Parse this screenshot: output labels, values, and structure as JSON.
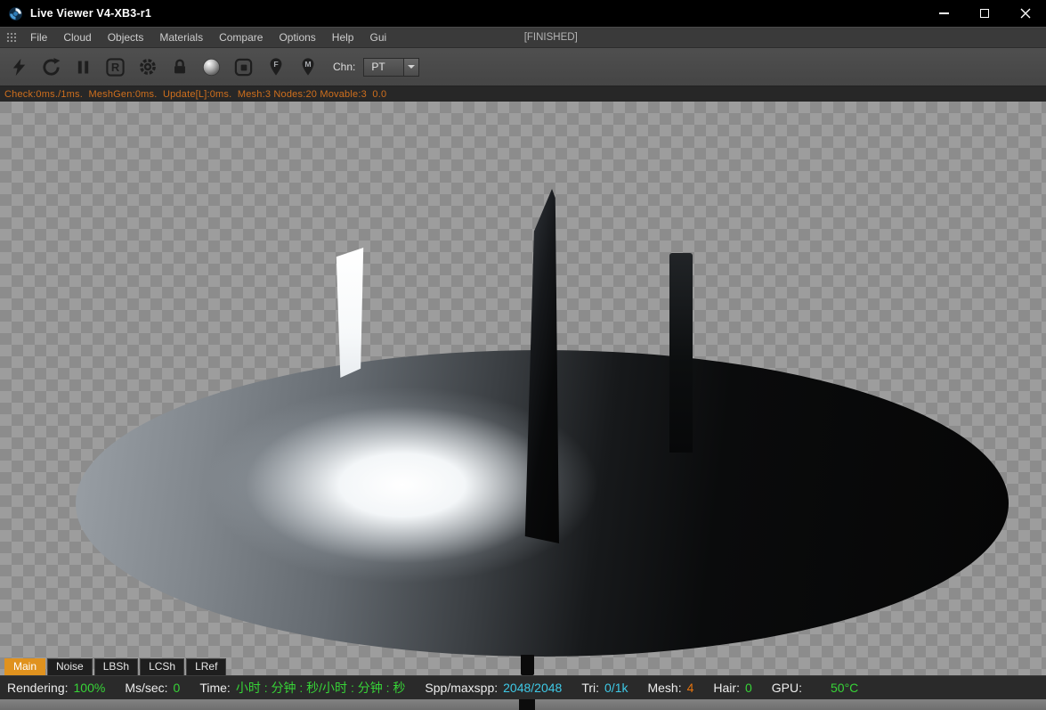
{
  "window": {
    "title": "Live Viewer V4-XB3-r1"
  },
  "menu": {
    "items": [
      "File",
      "Cloud",
      "Objects",
      "Materials",
      "Compare",
      "Options",
      "Help",
      "Gui"
    ],
    "finished": "[FINISHED]"
  },
  "toolbar": {
    "chn_label": "Chn:",
    "channel_value": "PT",
    "r_label": "R",
    "pin_f": "F",
    "pin_m": "M"
  },
  "stats_line": {
    "text": "Check:0ms./1ms.  MeshGen:0ms.  Update[L]:0ms.  Mesh:3 Nodes:20 Movable:3  0.0"
  },
  "tabs": [
    {
      "label": "Main",
      "active": true
    },
    {
      "label": "Noise",
      "active": false
    },
    {
      "label": "LBSh",
      "active": false
    },
    {
      "label": "LCSh",
      "active": false
    },
    {
      "label": "LRef",
      "active": false
    }
  ],
  "status_bar": {
    "rendering_label": "Rendering:",
    "rendering_value": "100%",
    "ms_label": "Ms/sec:",
    "ms_value": "0",
    "time_label": "Time:",
    "time_value": "小时 : 分钟 : 秒/小时 : 分钟 : 秒",
    "spp_label": "Spp/maxspp:",
    "spp_value": "2048/2048",
    "tri_label": "Tri:",
    "tri_value": "0/1k",
    "mesh_label": "Mesh:",
    "mesh_value": "4",
    "hair_label": "Hair:",
    "hair_value": "0",
    "gpu_label": "GPU:",
    "gpu_value": "50°C"
  },
  "colors": {
    "tab_active_orange": "#e0921e",
    "stats_orange": "#cf6f1d",
    "value_green": "#37d337",
    "value_cyan": "#3ec9e6",
    "value_orange": "#e4730e"
  }
}
